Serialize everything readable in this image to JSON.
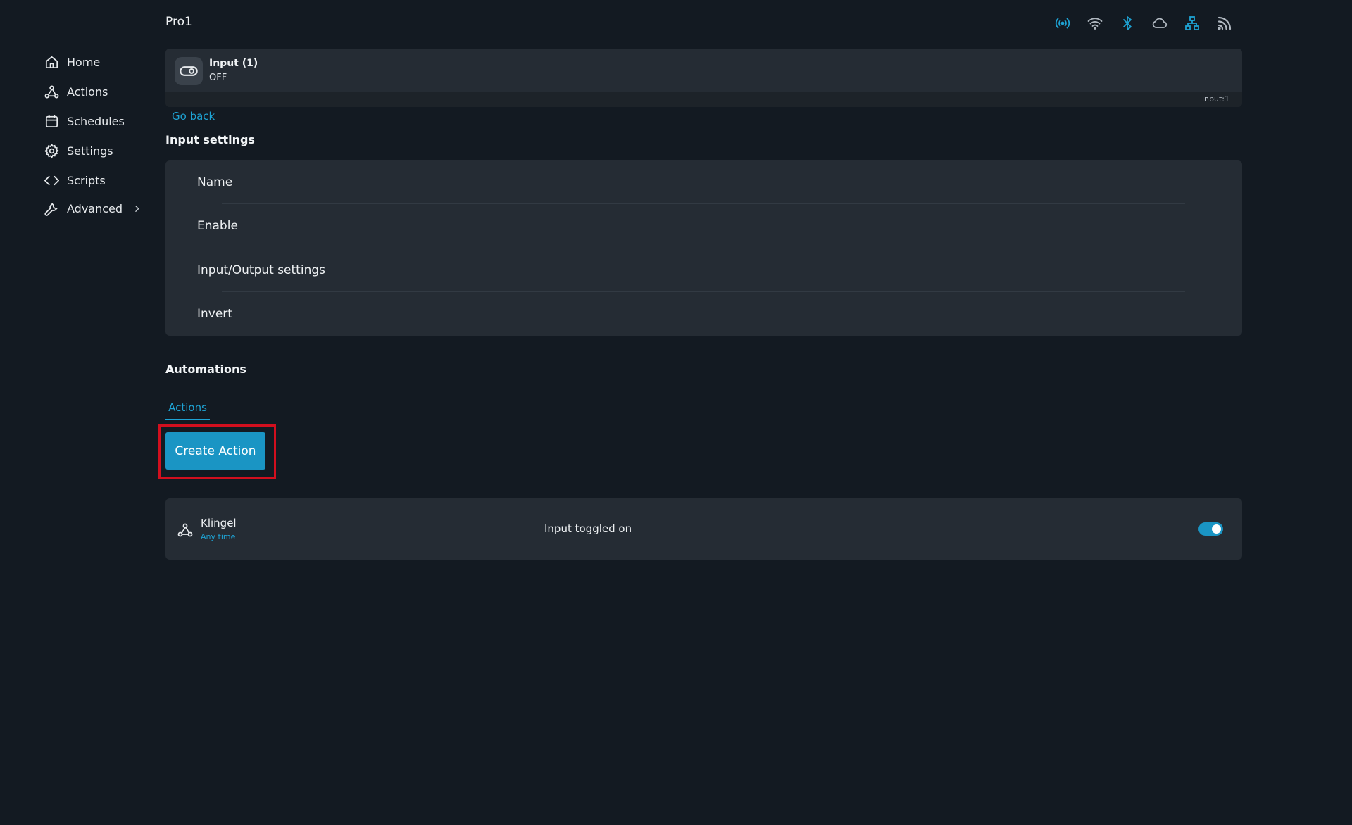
{
  "sidebar": {
    "items": [
      {
        "label": "Home",
        "icon": "home-icon"
      },
      {
        "label": "Actions",
        "icon": "webhook-icon"
      },
      {
        "label": "Schedules",
        "icon": "calendar-icon"
      },
      {
        "label": "Settings",
        "icon": "gear-icon"
      },
      {
        "label": "Scripts",
        "icon": "code-icon"
      },
      {
        "label": "Advanced",
        "icon": "wrench-icon"
      }
    ]
  },
  "header": {
    "title": "Pro1",
    "status_icons": [
      "access-point-icon",
      "wifi-icon",
      "bluetooth-icon",
      "cloud-icon",
      "ethernet-icon",
      "rss-icon"
    ],
    "colors": {
      "active": "#1ea3d4",
      "inactive": "#b0b8c0"
    }
  },
  "device": {
    "name": "Input (1)",
    "state": "OFF",
    "id": "input:1",
    "icon": "toggle-icon"
  },
  "go_back": "Go back",
  "input_settings": {
    "title": "Input settings",
    "rows": [
      "Name",
      "Enable",
      "Input/Output settings",
      "Invert"
    ]
  },
  "automations": {
    "title": "Automations",
    "tab": "Actions",
    "create_button": "Create Action",
    "actions": [
      {
        "name": "Klingel",
        "when": "Any time",
        "trigger": "Input toggled on",
        "enabled": true
      }
    ]
  },
  "colors": {
    "accent": "#1ea3d4",
    "background": "#131a22",
    "card": "#252c34",
    "highlight": "#d20f1e"
  }
}
